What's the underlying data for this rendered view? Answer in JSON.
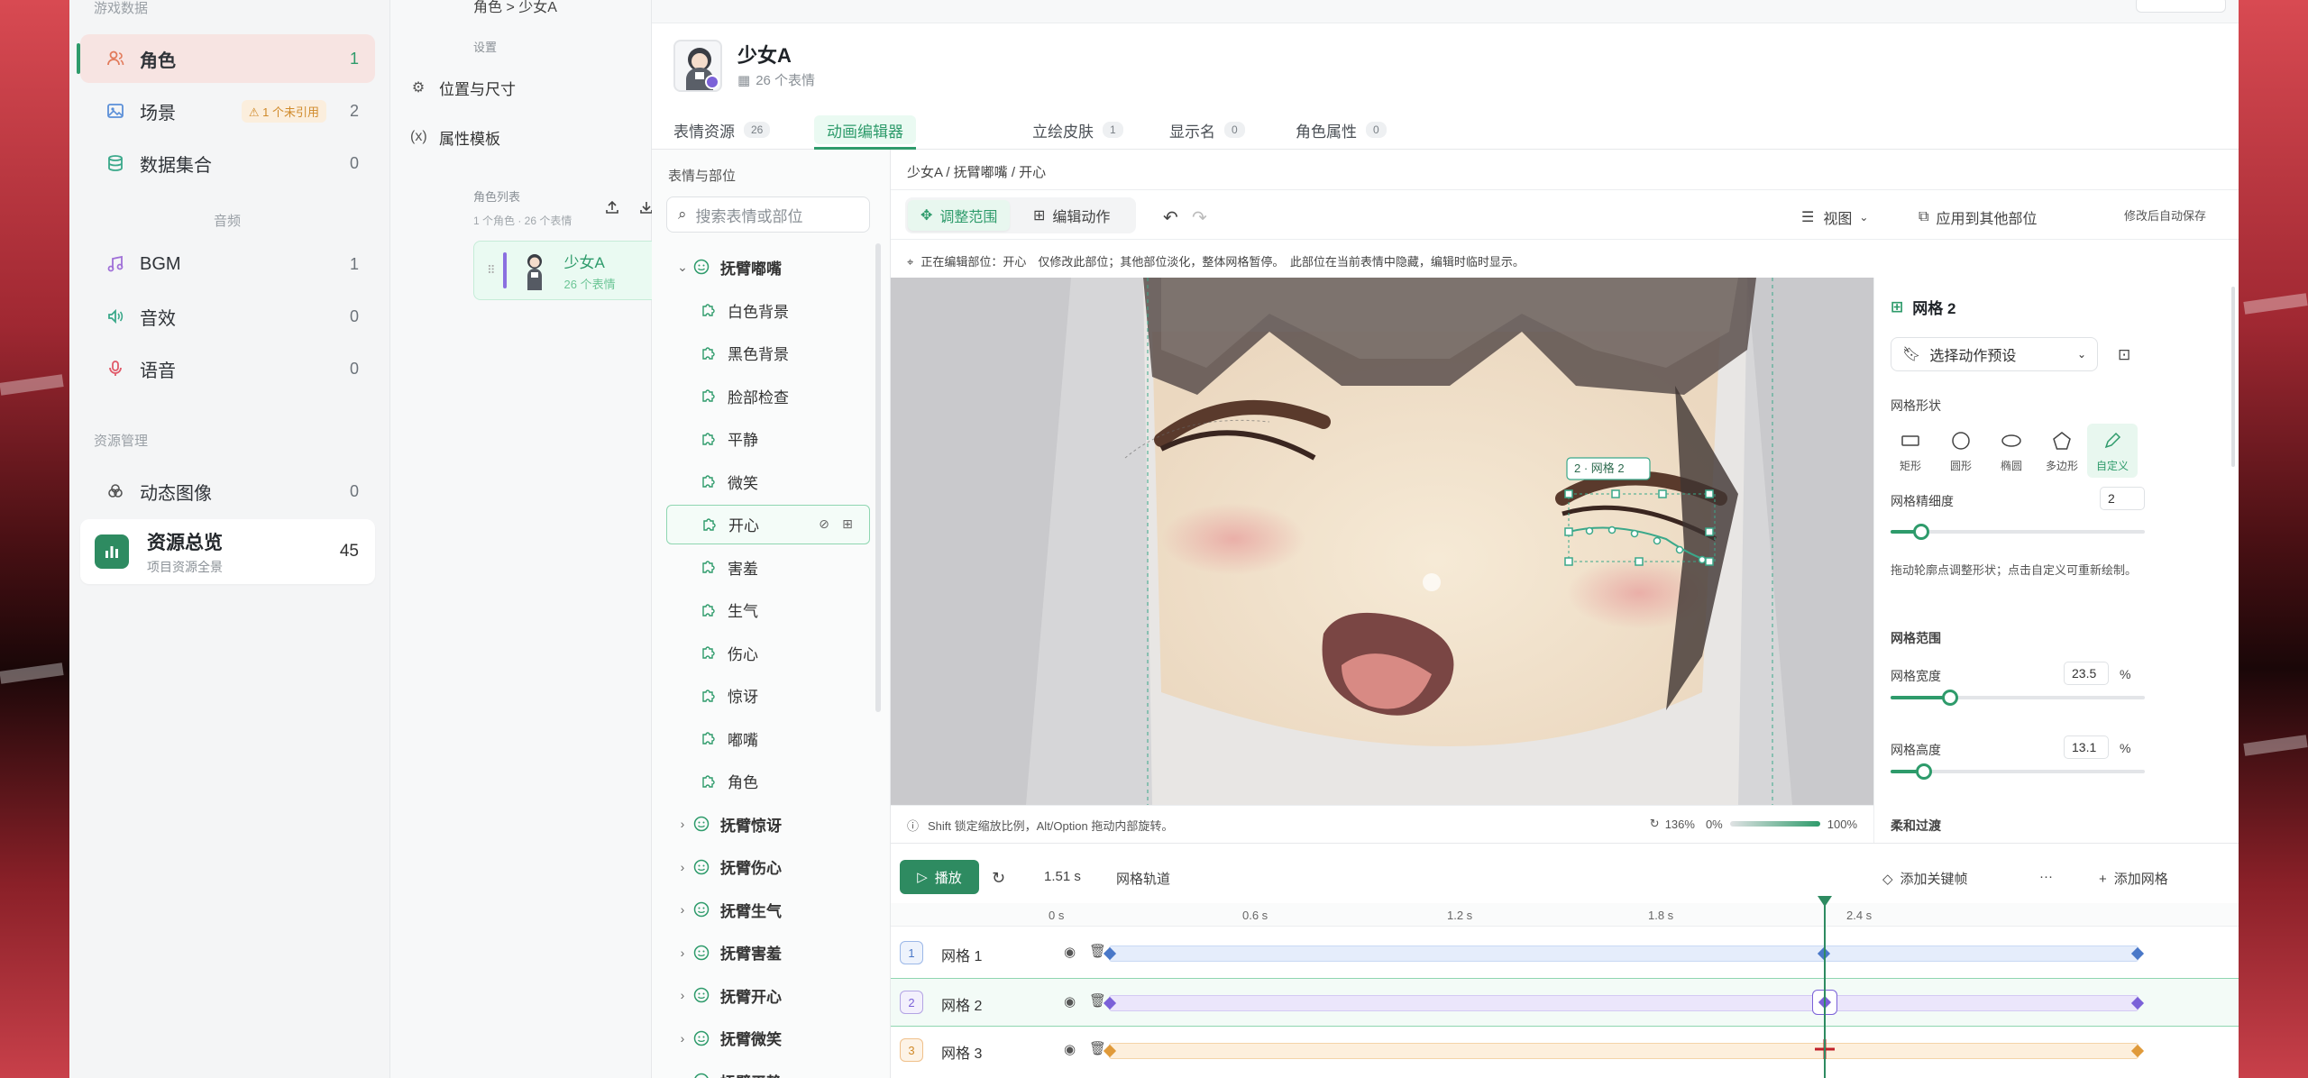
{
  "nav": {
    "section_game": "游戏数据",
    "items_game": [
      {
        "label": "角色",
        "count": "1"
      },
      {
        "label": "场景",
        "count": "2",
        "warn": "⚠ 1 个未引用"
      },
      {
        "label": "数据集合",
        "count": "0"
      }
    ],
    "section_audio": "音频",
    "items_audio": [
      {
        "label": "BGM",
        "count": "1"
      },
      {
        "label": "音效",
        "count": "0"
      },
      {
        "label": "语音",
        "count": "0"
      }
    ],
    "section_assets": "资源管理",
    "items_assets": [
      {
        "label": "动态图像",
        "count": "0"
      }
    ],
    "overview": {
      "title": "资源总览",
      "subtitle": "项目资源全景",
      "count": "45"
    }
  },
  "settings": {
    "section_label": "设置",
    "items": [
      {
        "label": "位置与尺寸"
      },
      {
        "label": "属性模板"
      }
    ],
    "char_list_label": "角色列表",
    "char_list_sub": "1 个角色 · 26 个表情",
    "character": {
      "name": "少女A",
      "sub": "26 个表情"
    }
  },
  "header": {
    "breadcrumb": "角色 > 少女A",
    "char_name": "少女A",
    "char_sub": "26 个表情"
  },
  "tabs": [
    {
      "label": "表情资源",
      "count": "26"
    },
    {
      "label": "动画编辑器",
      "count": ""
    },
    {
      "label": "立绘皮肤",
      "count": "1"
    },
    {
      "label": "显示名",
      "count": "0"
    },
    {
      "label": "角色属性",
      "count": "0"
    }
  ],
  "tree": {
    "heading": "表情与部位",
    "search_placeholder": "搜索表情或部位",
    "group_open": "抚臂嘟嘴",
    "children": [
      "白色背景",
      "黑色背景",
      "脸部检查",
      "平静",
      "微笑",
      "开心",
      "害羞",
      "生气",
      "伤心",
      "惊讶",
      "嘟嘴",
      "角色"
    ],
    "groups": [
      "抚臂惊讶",
      "抚臂伤心",
      "抚臂生气",
      "抚臂害羞",
      "抚臂开心",
      "抚臂微笑",
      "抚臂平静"
    ]
  },
  "editor": {
    "breadcrumb": "少女A / 抚臂嘟嘴 / 开心",
    "mode_adjust": "调整范围",
    "mode_edit": "编辑动作",
    "view_label": "视图",
    "apply_label": "应用到其他部位",
    "autosave": "修改后自动保存",
    "info_line": "正在编辑部位：开心　仅修改此部位；其他部位淡化，整体网格暂停。　此部位在当前表情中隐藏，编辑时临时显示。",
    "mesh_tag": "2 · 网格 2",
    "footer_tip": "Shift 锁定缩放比例，Alt/Option 拖动内部旋转。",
    "zoom": "136%",
    "opacity_from": "0%",
    "opacity_to": "100%"
  },
  "props": {
    "title": "网格 2",
    "preset_placeholder": "选择动作预设",
    "shape_label": "网格形状",
    "shapes": [
      "矩形",
      "圆形",
      "椭圆",
      "多边形",
      "自定义"
    ],
    "density_label": "网格精细度",
    "density_value": "2",
    "density_level": 0.12,
    "hint": "拖动轮廓点调整形状；点击自定义可重新绘制。",
    "range_label": "网格范围",
    "width_label": "网格宽度",
    "width_value": "23.5",
    "width_level": 0.235,
    "height_label": "网格高度",
    "height_value": "13.1",
    "height_level": 0.131,
    "percent": "%",
    "next_section": "柔和过渡"
  },
  "timeline": {
    "play_label": "播放",
    "time": "1.51 s",
    "track_label": "网格轨道",
    "add_keyframe": "添加关键帧",
    "more": "···",
    "add_mesh": "添加网格",
    "ticks": [
      "0 s",
      "0.6 s",
      "1.2 s",
      "1.8 s",
      "2.4 s"
    ],
    "tracks": [
      {
        "num": "1",
        "name": "网格 1"
      },
      {
        "num": "2",
        "name": "网格 2"
      },
      {
        "num": "3",
        "name": "网格 3"
      }
    ]
  }
}
